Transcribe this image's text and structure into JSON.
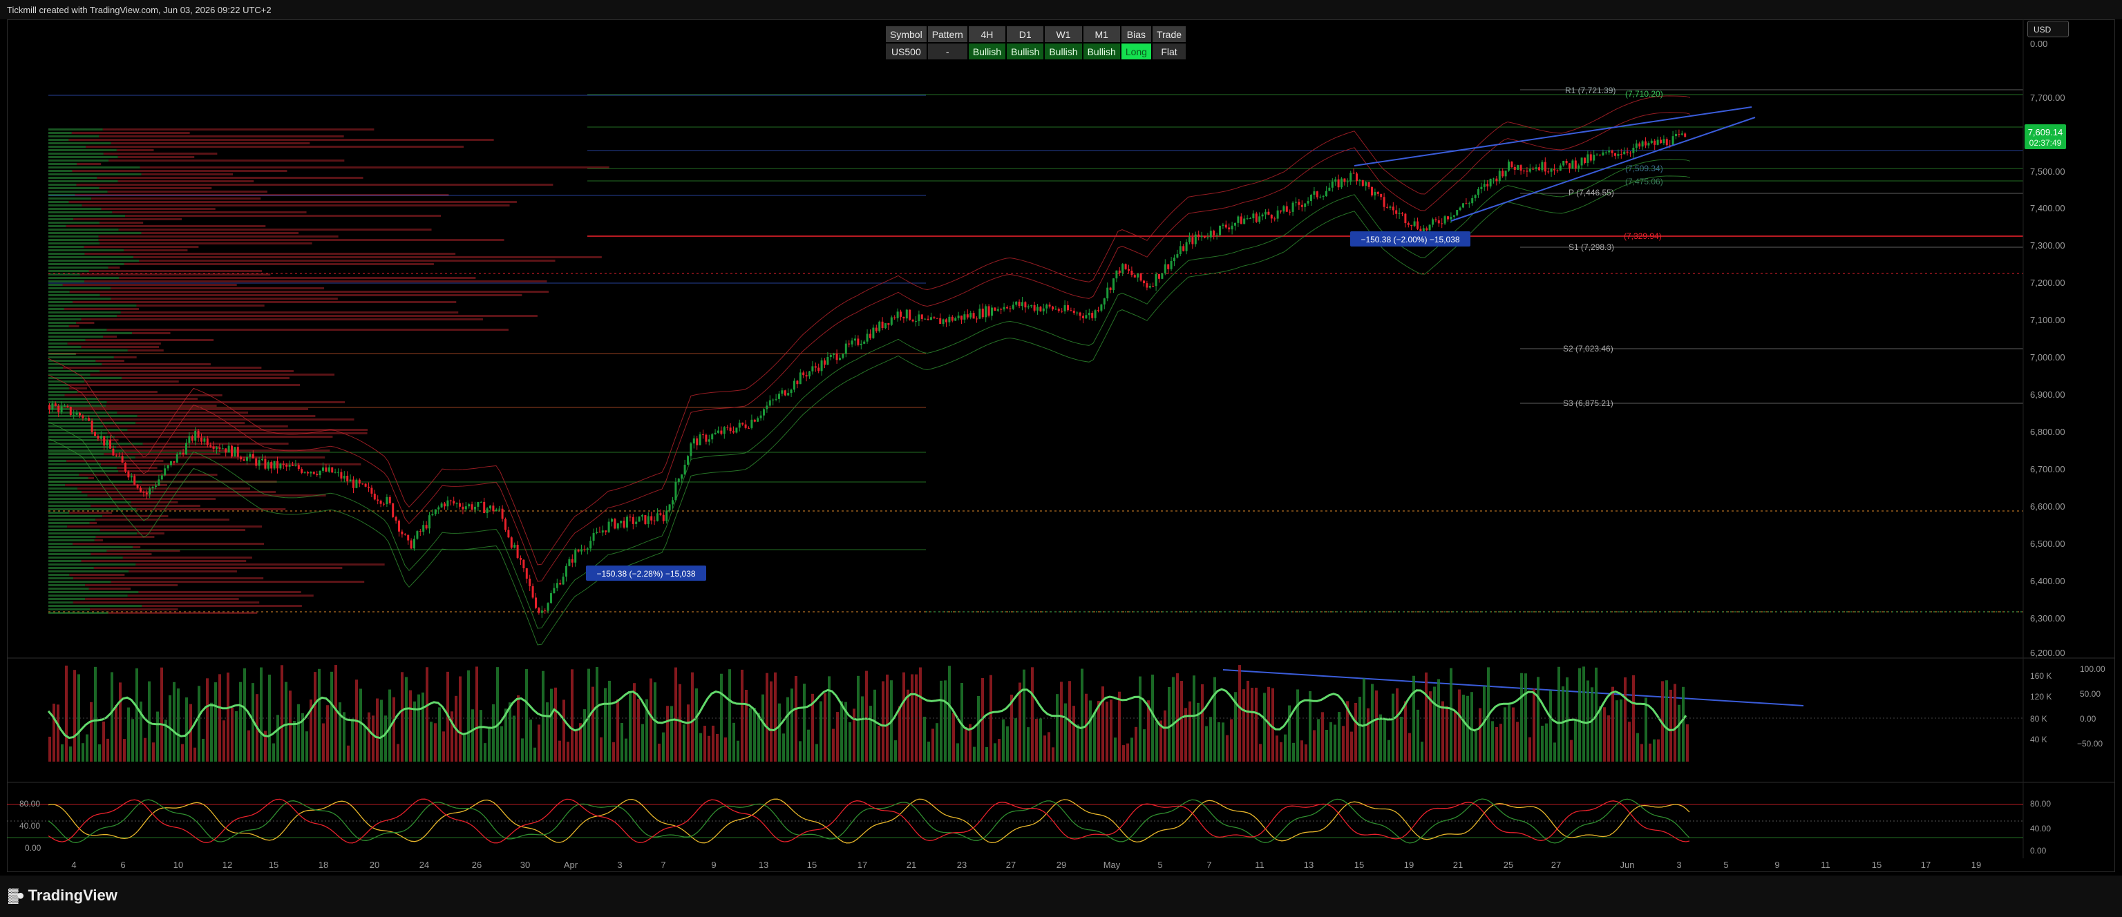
{
  "header": {
    "text": "Tickmill created with TradingView.com, Jun 03, 2026 09:22 UTC+2"
  },
  "brand": {
    "name": "TradingView"
  },
  "currency": {
    "label": "USD"
  },
  "table": {
    "headers": [
      "Symbol",
      "Pattern",
      "4H",
      "D1",
      "W1",
      "M1",
      "Bias",
      "Trade"
    ],
    "row": [
      "US500",
      "-",
      "Bullish",
      "Bullish",
      "Bullish",
      "Bullish",
      "Long",
      "Flat"
    ]
  },
  "price_axis": {
    "labels": [
      "0.00",
      "7,700.00",
      "7,500.00",
      "7,400.00",
      "7,300.00",
      "7,200.00",
      "7,100.00",
      "7,000.00",
      "6,900.00",
      "6,800.00",
      "6,700.00",
      "6,600.00",
      "6,500.00",
      "6,400.00",
      "6,300.00",
      "6,200.00"
    ],
    "current_price": "7,609.14",
    "countdown": "02:37:49"
  },
  "pivots": {
    "r1": "R1 (7,721.39)",
    "r1_alt": "(7,710.20)",
    "p": "P (7,446.55)",
    "red": "(7,329.94)",
    "s1": "S1 (7,298.3)",
    "s2": "S2 (7,023.46)",
    "s3": "S3 (6,875.21)",
    "mid1": "(7,509.34)",
    "mid2": "(7,475.06)"
  },
  "measures": {
    "left": "−150.38 (−2.28%) −15,038",
    "right": "−150.38 (−2.00%) −15,038"
  },
  "volume_axis": {
    "left": [
      "160 K",
      "120 K",
      "80 K",
      "40 K"
    ],
    "right": [
      "100.00",
      "50.00",
      "0.00",
      "−50.00"
    ]
  },
  "stoch_axis": {
    "left": [
      "80.00",
      "40.00",
      "0.00"
    ],
    "right": [
      "80.00",
      "40.00",
      "0.00"
    ]
  },
  "time_axis": [
    "4",
    "6",
    "10",
    "12",
    "15",
    "18",
    "20",
    "24",
    "26",
    "30",
    "Apr",
    "3",
    "7",
    "9",
    "13",
    "15",
    "17",
    "21",
    "23",
    "27",
    "29",
    "May",
    "5",
    "7",
    "11",
    "13",
    "15",
    "19",
    "21",
    "25",
    "27",
    "Jun",
    "3",
    "5",
    "9",
    "11",
    "15",
    "17",
    "19"
  ],
  "colors": {
    "bull": "#1b9b3a",
    "bear": "#e8212b",
    "accent": "#14e04f",
    "band_red": "#b8232a",
    "band_green": "#2f8d2f",
    "trendline": "#3a5cd9"
  }
}
